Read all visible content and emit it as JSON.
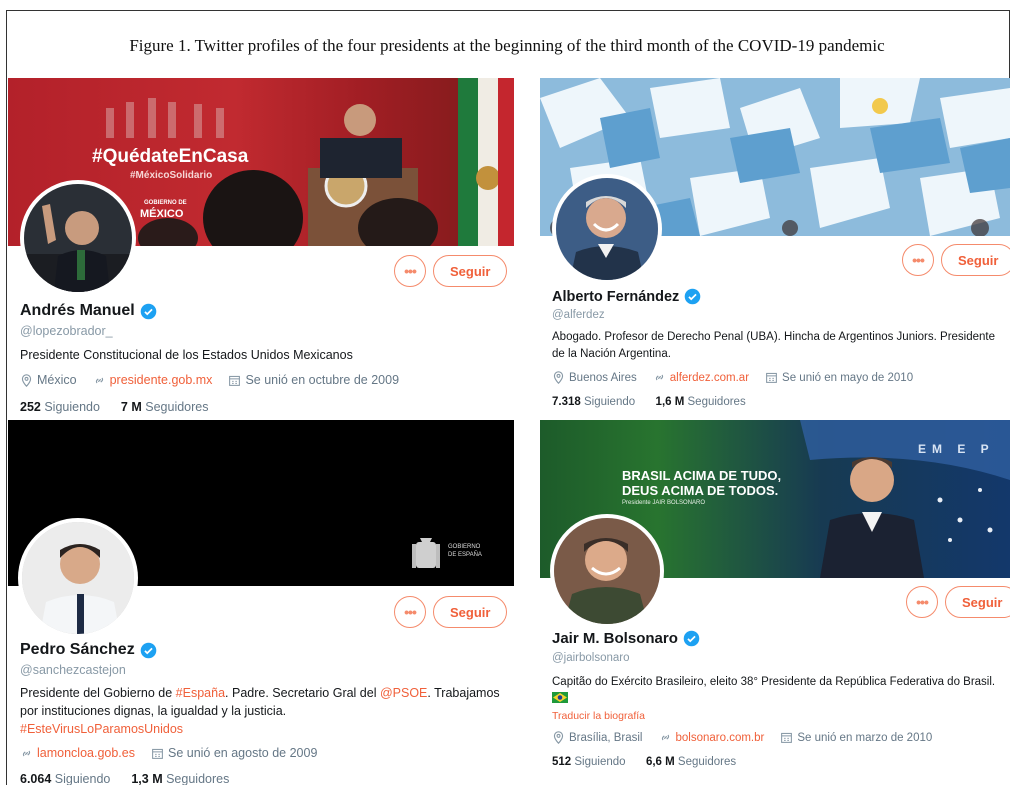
{
  "caption": "Figure 1. Twitter profiles of the four presidents at the beginning of the third month of the COVID-19 pandemic",
  "buttons": {
    "more": "•••",
    "follow": "Seguir"
  },
  "profiles": [
    {
      "banner_text": {
        "hashtag": "#QuédateEnCasa",
        "sub": "#MéxicoSolidario",
        "gov_small": "GOBIERNO DE",
        "gov": "MÉXICO"
      },
      "name": "Andrés Manuel",
      "handle": "@lopezobrador_",
      "bio": "Presidente Constitucional de los Estados Unidos Mexicanos",
      "location": "México",
      "website": "presidente.gob.mx",
      "joined": "Se unió en octubre de 2009",
      "following_count": "252",
      "following_label": "Siguiendo",
      "followers_count": "7 M",
      "followers_label": "Seguidores"
    },
    {
      "name": "Alberto Fernández",
      "handle": "@alferdez",
      "bio_line1": "Abogado. Profesor de Derecho Penal (UBA). Hincha de Argentinos Juniors. Presidente",
      "bio_line2": "de la Nación Argentina.",
      "location": "Buenos Aires",
      "website": "alferdez.com.ar",
      "joined": "Se unió en mayo de 2010",
      "following_count": "7.318",
      "following_label": "Siguiendo",
      "followers_count": "1,6 M",
      "followers_label": "Seguidores"
    },
    {
      "banner_text": {
        "gov_line1": "GOBIERNO",
        "gov_line2": "DE ESPAÑA"
      },
      "name": "Pedro Sánchez",
      "handle": "@sanchezcastejon",
      "bio_pre": "Presidente del Gobierno de ",
      "bio_tag1": "#España",
      "bio_mid": ". Padre. Secretario Gral del ",
      "bio_tag2": "@PSOE",
      "bio_post": ". Trabajamos",
      "bio_line2": "por instituciones dignas, la igualdad y la justicia.",
      "bio_tag3": "#EsteVirusLoParamosUnidos",
      "website": "lamoncloa.gob.es",
      "joined": "Se unió en agosto de 2009",
      "following_count": "6.064",
      "following_label": "Siguiendo",
      "followers_count": "1,3 M",
      "followers_label": "Seguidores"
    },
    {
      "banner_text": {
        "line1": "BRASIL ACIMA DE TUDO,",
        "line2": "DEUS ACIMA DE TODOS.",
        "sub": "Presidente JAIR BOLSONARO",
        "flag_text": "EM E P"
      },
      "name": "Jair M. Bolsonaro",
      "handle": "@jairbolsonaro",
      "bio": "Capitão do Exército Brasileiro, eleito 38° Presidente da República Federativa do Brasil.",
      "translate": "Traducir la biografía",
      "location": "Brasília, Brasil",
      "website": "bolsonaro.com.br",
      "joined": "Se unió en marzo de 2010",
      "following_count": "512",
      "following_label": "Siguiendo",
      "followers_count": "6,6 M",
      "followers_label": "Seguidores"
    }
  ]
}
